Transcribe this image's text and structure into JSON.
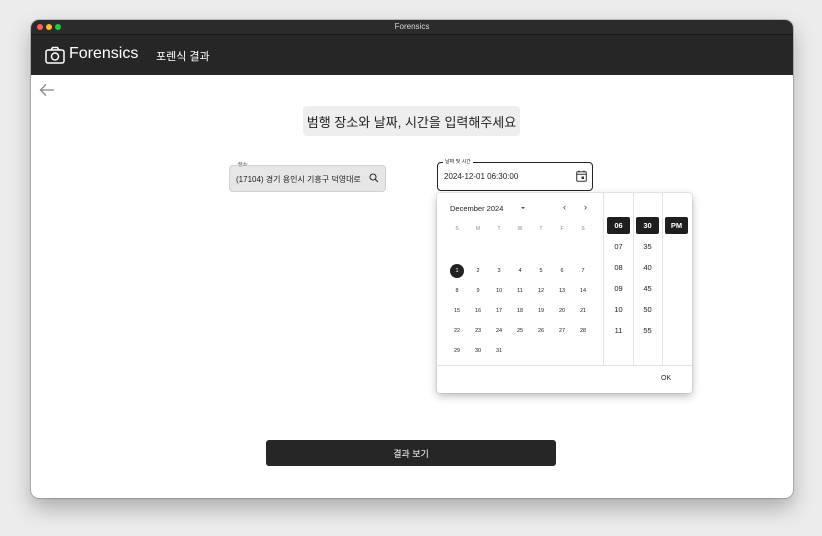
{
  "window": {
    "title": "Forensics"
  },
  "appbar": {
    "app_name": "Forensics",
    "nav_label": "포렌식 결과",
    "logo_icon": "camera-icon"
  },
  "main": {
    "heading": "범행 장소와 날짜, 시간을 입력해주세요",
    "location": {
      "label": "장소",
      "value": "(17104) 경기 용인시 기흥구 덕영대로"
    },
    "datetime": {
      "label": "날짜 및 시간",
      "value": "2024-12-01 06:30:00"
    },
    "submit_label": "결과 보기"
  },
  "picker": {
    "month_label": "December 2024",
    "prev_icon": "‹",
    "next_icon": "›",
    "weekdays": [
      "S",
      "M",
      "T",
      "W",
      "T",
      "F",
      "S"
    ],
    "weeks": [
      [
        "1",
        "2",
        "3",
        "4",
        "5",
        "6",
        "7"
      ],
      [
        "8",
        "9",
        "10",
        "11",
        "12",
        "13",
        "14"
      ],
      [
        "15",
        "16",
        "17",
        "18",
        "19",
        "20",
        "21"
      ],
      [
        "22",
        "23",
        "24",
        "25",
        "26",
        "27",
        "28"
      ],
      [
        "29",
        "30",
        "31",
        "",
        "",
        "",
        ""
      ]
    ],
    "selected_day": "1",
    "hours": [
      "06",
      "07",
      "08",
      "09",
      "10",
      "11"
    ],
    "minutes": [
      "30",
      "35",
      "40",
      "45",
      "50",
      "55"
    ],
    "meridiem": [
      "PM"
    ],
    "selected_hour": "06",
    "selected_minute": "30",
    "selected_meridiem": "PM",
    "ok_label": "OK"
  },
  "colors": {
    "appbar": "#262626",
    "selected": "#1f1f1f",
    "background": "#ffffff"
  }
}
